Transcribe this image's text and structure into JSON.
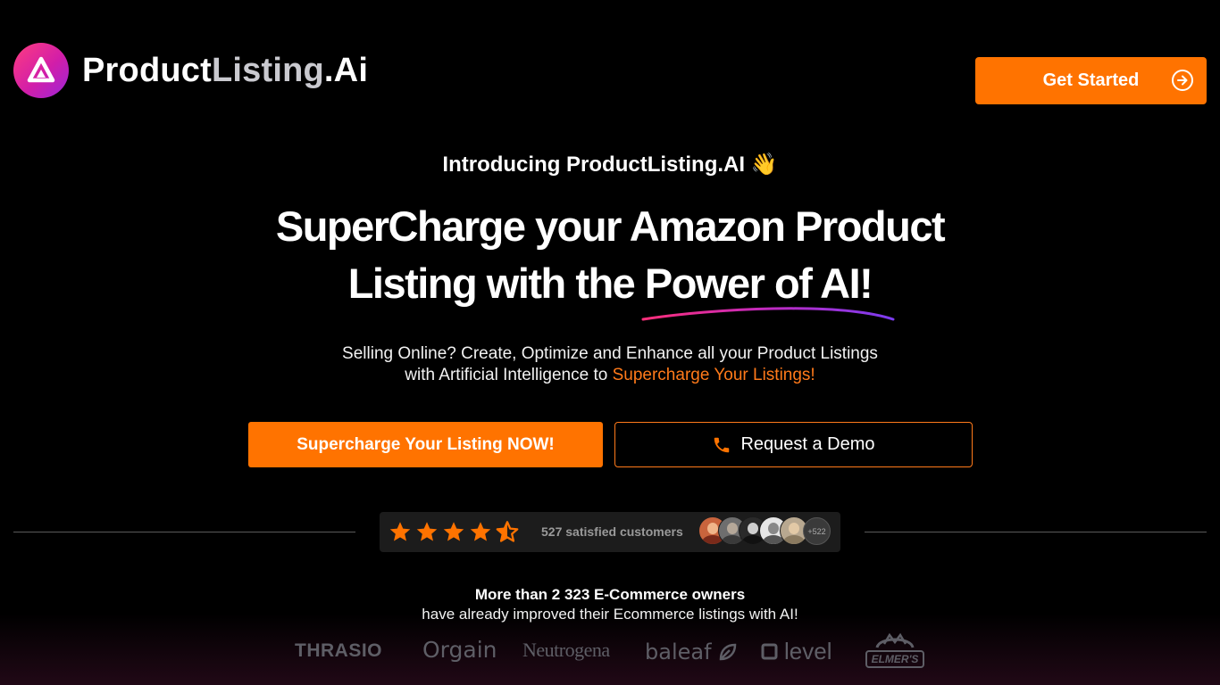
{
  "header": {
    "logo_word1": "Product",
    "logo_word2": "Listing",
    "logo_word3": ".Ai",
    "get_started_label": "Get Started"
  },
  "hero": {
    "intro": "Introducing ProductListing.AI 👋",
    "headline_line1": "SuperCharge your Amazon Product",
    "headline_line2": "Listing with the Power of AI!",
    "subtext_line1": "Selling Online? Create, Optimize and Enhance all your Product Listings",
    "subtext_line2_prefix": "with Artificial Intelligence to ",
    "subtext_accent": "Supercharge Your Listings!",
    "cta_primary": "Supercharge Your Listing NOW!",
    "cta_demo": "Request a Demo"
  },
  "rating": {
    "stars": 4.5,
    "max_stars": 5,
    "satisfied_text": "527 satisfied customers",
    "more_count": "+522"
  },
  "social_proof": {
    "line1": "More than 2 323 E-Commerce owners",
    "line2": "have already improved their Ecommerce listings with AI!"
  },
  "brands": [
    "THRASIO",
    "Orgain",
    "Neutrogena",
    "baleaf",
    "level",
    "ELMER'S"
  ],
  "colors": {
    "accent": "#ff7300",
    "background": "#000000",
    "logo_gradient_start": "#ff3d7f",
    "logo_gradient_end": "#9b26d9"
  }
}
